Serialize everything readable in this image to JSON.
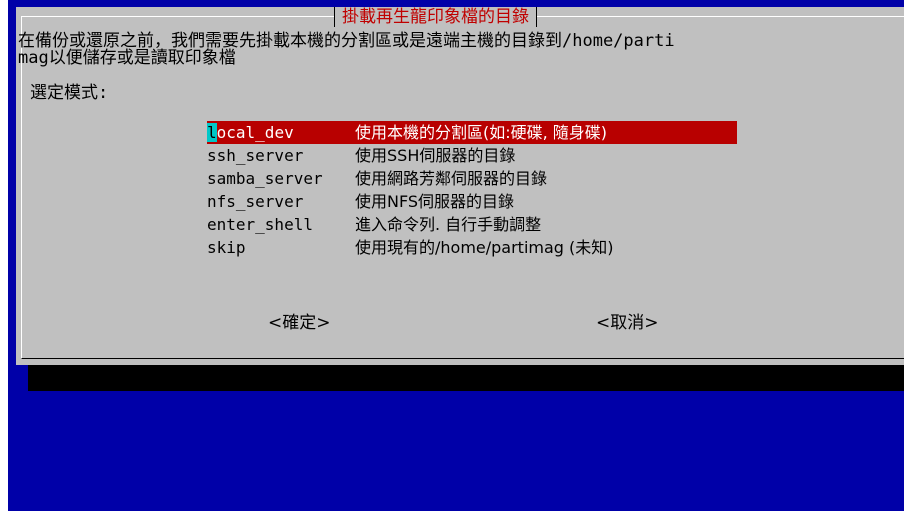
{
  "dialog": {
    "title": "掛載再生龍印象檔的目錄",
    "message_line1": "在備份或還原之前，我們需要先掛載本機的分割區或是遠端主機的目錄到/home/parti",
    "message_line2": "mag以便儲存或是讀取印象檔",
    "select_label": "選定模式:",
    "selected_tag_first_char": "l",
    "selected_tag_rest": "ocal_dev",
    "menu_items": [
      {
        "tag": "local_dev",
        "desc": "使用本機的分割區(如:硬碟, 隨身碟)"
      },
      {
        "tag": "ssh_server",
        "desc": "使用SSH伺服器的目錄"
      },
      {
        "tag": "samba_server",
        "desc": "使用網路芳鄰伺服器的目錄"
      },
      {
        "tag": "nfs_server",
        "desc": "使用NFS伺服器的目錄"
      },
      {
        "tag": "enter_shell",
        "desc": "進入命令列. 自行手動調整"
      },
      {
        "tag": "skip",
        "desc": "使用現有的/home/partimag (未知)"
      }
    ],
    "ok_label": "<確定>",
    "cancel_label": "<取消>"
  },
  "colors": {
    "background": "#0000a8",
    "dialog": "#c0c0c0",
    "title": "#c00000",
    "selection": "#b80000",
    "cursor": "#00c8c8"
  }
}
